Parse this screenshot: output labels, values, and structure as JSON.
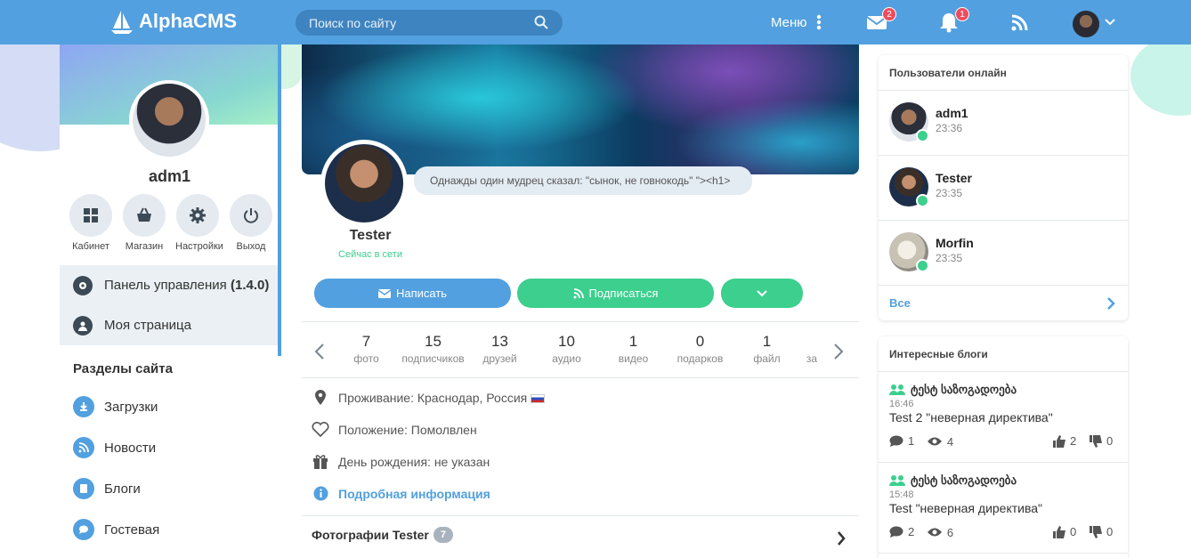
{
  "topbar": {
    "logo": "AlphaCMS",
    "search_placeholder": "Поиск по сайту",
    "menu_label": "Меню",
    "mail_count": "2",
    "notif_count": "1"
  },
  "profile": {
    "name": "adm1",
    "quick": [
      {
        "label": "Кабинет"
      },
      {
        "label": "Магазин"
      },
      {
        "label": "Настройки"
      },
      {
        "label": "Выход"
      }
    ],
    "panel": "Панель управления",
    "panel_version": "(1.4.0)",
    "mypage": "Моя страница"
  },
  "sections": {
    "title": "Разделы сайта",
    "items": [
      "Загрузки",
      "Новости",
      "Блоги",
      "Гостевая"
    ]
  },
  "user": {
    "quote": "Однажды один мудрец сказал: \"сынок, не говнокодь\" \"><h1>",
    "name": "Tester",
    "status": "Сейчас в сети",
    "write": "Написать",
    "subscribe": "Подписаться",
    "stats": [
      {
        "n": "7",
        "l": "фото"
      },
      {
        "n": "15",
        "l": "подписчиков"
      },
      {
        "n": "13",
        "l": "друзей"
      },
      {
        "n": "10",
        "l": "аудио"
      },
      {
        "n": "1",
        "l": "видео"
      },
      {
        "n": "0",
        "l": "подарков"
      },
      {
        "n": "1",
        "l": "файл"
      }
    ],
    "stats_cut": "за",
    "residence": "Проживание: Краснодар, Россия",
    "position": "Положение: Помолвлен",
    "birthday": "День рождения: не указан",
    "more": "Подробная информация",
    "photos_title": "Фотографии Tester",
    "photos_count": "7"
  },
  "online": {
    "title": "Пользователи онлайн",
    "users": [
      {
        "name": "adm1",
        "time": "23:36"
      },
      {
        "name": "Tester",
        "time": "23:35"
      },
      {
        "name": "Morfin",
        "time": "23:35"
      }
    ],
    "all": "Все"
  },
  "blogs": {
    "title": "Интересные блоги",
    "items": [
      {
        "author": "ტესტ საზოგადოება",
        "time": "16:46",
        "title": "Test 2 \"неверная директива\"",
        "comments": "1",
        "views": "4",
        "likes": "2",
        "dislikes": "0"
      },
      {
        "author": "ტესტ საზოგადოება",
        "time": "15:48",
        "title": "Test \"неверная директива\"",
        "comments": "2",
        "views": "6",
        "likes": "0",
        "dislikes": "0"
      }
    ]
  },
  "colors": {
    "primary": "#52a0df",
    "green": "#3ccf8e",
    "badge": "#ec4d5e"
  }
}
